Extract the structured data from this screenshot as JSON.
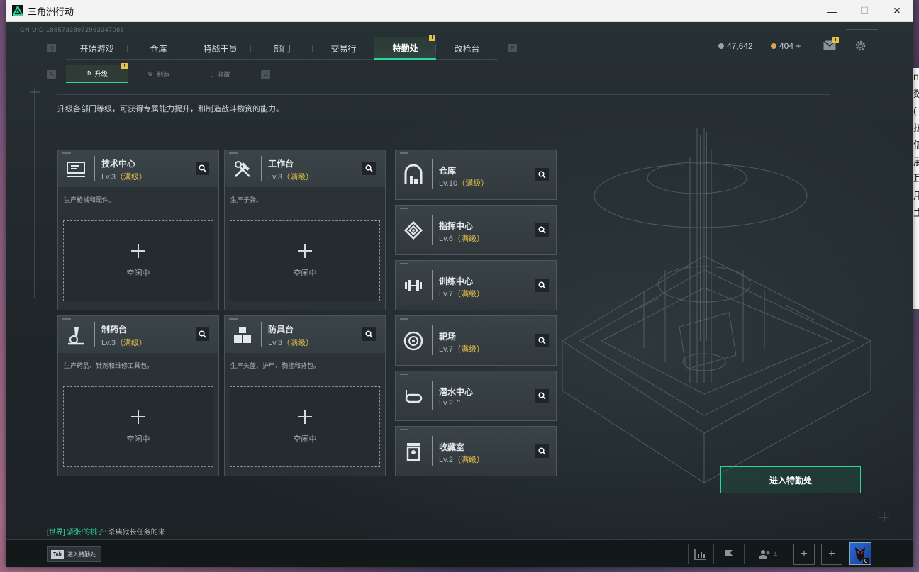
{
  "window": {
    "title": "三角洲行动",
    "minimize": "—",
    "maximize": "☐",
    "close": "✕"
  },
  "uid": "CN UID 18557338972963347088",
  "nav": {
    "left_key": "Q",
    "right_key": "E",
    "tabs": [
      "开始游戏",
      "仓库",
      "特战干员",
      "部门",
      "交易行",
      "特勤处",
      "改枪台"
    ],
    "active": "特勤处",
    "badge": "!"
  },
  "currency": {
    "coins": "47,642",
    "premium": "404 +",
    "coin_color": "#9aa4a8",
    "premium_color": "#d8a64a"
  },
  "subnav": {
    "left_key": "A",
    "right_key": "D",
    "tabs": [
      "升级",
      "制造",
      "收藏"
    ],
    "active": "升级",
    "badge": "!"
  },
  "description": "升级各部门等级，可获得专属能力提升，和制造战斗物资的能力。",
  "workshops": [
    {
      "name": "技术中心",
      "level": "Lv.3",
      "status": "（满级）",
      "desc": "生产枪械和配件。",
      "slot": "空闲中",
      "icon": "computer-icon"
    },
    {
      "name": "工作台",
      "level": "Lv.3",
      "status": "（满级）",
      "desc": "生产子弹。",
      "slot": "空闲中",
      "icon": "tools-icon"
    },
    {
      "name": "制药台",
      "level": "Lv.3",
      "status": "（满级）",
      "desc": "生产药品、针剂和维修工具包。",
      "slot": "空闲中",
      "icon": "microscope-icon"
    },
    {
      "name": "防具台",
      "level": "Lv.3",
      "status": "（满级）",
      "desc": "生产头盔、护甲、胸挂和背包。",
      "slot": "空闲中",
      "icon": "cubes-icon"
    }
  ],
  "facilities": [
    {
      "name": "仓库",
      "level": "Lv.10",
      "status": "（满级）",
      "icon": "warehouse-icon"
    },
    {
      "name": "指挥中心",
      "level": "Lv.6",
      "status": "（满级）",
      "icon": "command-icon"
    },
    {
      "name": "训练中心",
      "level": "Lv.7",
      "status": "（满级）",
      "icon": "dumbbell-icon"
    },
    {
      "name": "靶场",
      "level": "Lv.7",
      "status": "（满级）",
      "icon": "target-icon"
    },
    {
      "name": "潜水中心",
      "level": "Lv.2",
      "status": "",
      "icon": "diving-mask-icon"
    },
    {
      "name": "收藏室",
      "level": "Lv.2",
      "status": "（满级）",
      "icon": "collection-icon"
    }
  ],
  "enter_button": "进入特勤处",
  "chat": {
    "channel": "[世界]",
    "sender": "紧张f的桃子:",
    "message": "杀典狱长任务的来"
  },
  "bottom": {
    "tab_key": "Tab",
    "tab_label": "进入特勤处",
    "friends_count": "4",
    "avatar_level": "0"
  },
  "colors": {
    "accent": "#2fd49a",
    "gold": "#e6c04c",
    "bg": "#1d2327"
  }
}
